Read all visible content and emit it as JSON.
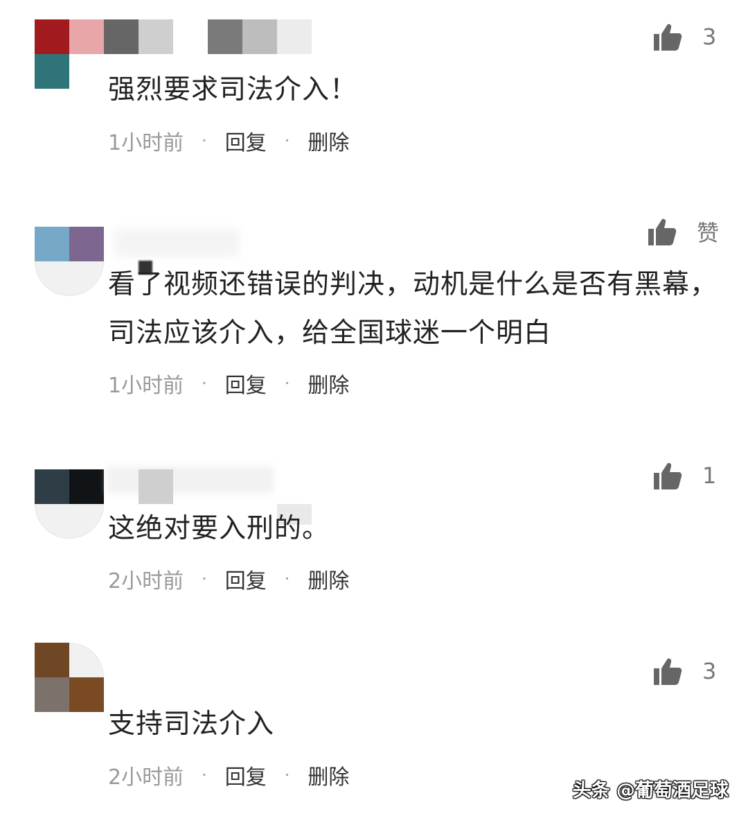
{
  "colors": {
    "text": "#222222",
    "meta_text": "#999999",
    "action_text": "#333333",
    "like_icon": "#666666"
  },
  "comments": [
    {
      "content": "强烈要求司法介入！",
      "time": "1小时前",
      "reply_label": "回复",
      "delete_label": "删除",
      "likes": "3",
      "avatar_colors": [
        "#a11a1e",
        "#2f7478"
      ],
      "name_colors": [
        "#e8a6a8",
        "#666666",
        "#cfcfcf",
        "#7a7a7a",
        "#bdbdbd"
      ]
    },
    {
      "content": "看了视频还错误的判决，动机是什么是否有黑幕，司法应该介入，给全国球迷一个明白",
      "time": "1小时前",
      "reply_label": "回复",
      "delete_label": "删除",
      "likes": "赞",
      "avatar_colors": [
        "#76a9c8",
        "#7d6690"
      ],
      "name_colors": []
    },
    {
      "content": "这绝对要入刑的。",
      "time": "2小时前",
      "reply_label": "回复",
      "delete_label": "删除",
      "likes": "1",
      "avatar_colors": [
        "#2e3d46",
        "#111417"
      ],
      "name_colors": [
        "#cfcfcf",
        "#e9e9e9"
      ]
    },
    {
      "content": "支持司法介入",
      "time": "2小时前",
      "reply_label": "回复",
      "delete_label": "删除",
      "likes": "3",
      "avatar_colors": [
        "#6f4724",
        "#7c716b",
        "#7a4a22"
      ],
      "name_colors": []
    }
  ],
  "watermark": "头条 @葡萄酒足球",
  "icons": {
    "like": "thumbs-up-icon"
  }
}
